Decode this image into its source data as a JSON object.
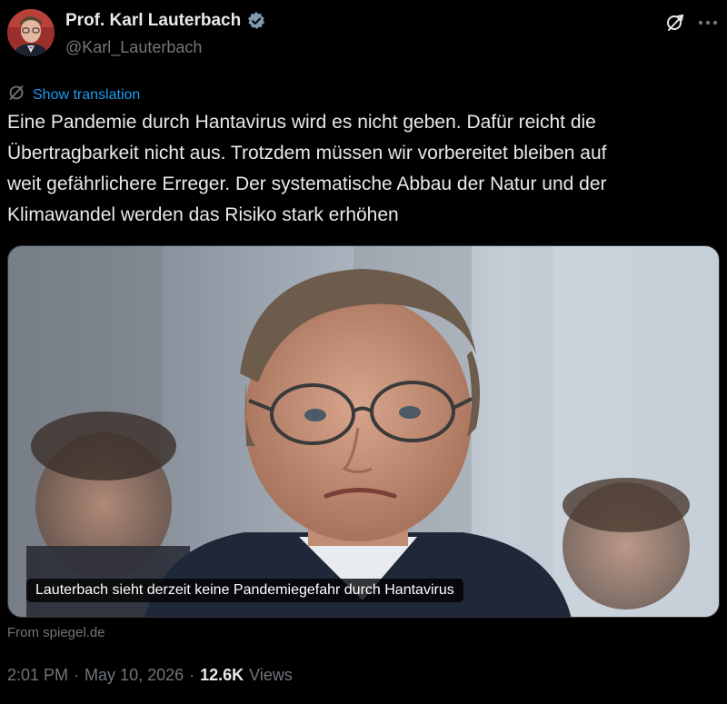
{
  "author": {
    "name": "Prof. Karl Lauterbach",
    "handle": "@Karl_Lauterbach",
    "verified": true
  },
  "header_icons": [
    "grok-icon",
    "more-icon"
  ],
  "translation": {
    "label": "Show translation"
  },
  "tweet": {
    "text_lines": [
      "Eine Pandemie durch Hantavirus wird es nicht geben. Dafür reicht die",
      "Übertragbarkeit nicht aus. Trotzdem müssen wir vorbereitet bleiben auf",
      "weit gefährlichere Erreger. Der systematische Abbau der Natur und der",
      "Klimawandel werden das Risiko stark erhöhen"
    ]
  },
  "card": {
    "caption": "Lauterbach sieht derzeit keine Pandemiegefahr durch Hantavirus",
    "source": "From spiegel.de"
  },
  "meta": {
    "time": "2:01 PM",
    "separator": "·",
    "date": "May 10, 2026",
    "views_count": "12.6K",
    "views_label": "Views"
  },
  "colors": {
    "background": "#000000",
    "text": "#e7e9ea",
    "muted": "#71767b",
    "link": "#1d9bf0",
    "verified": "#829aab"
  }
}
